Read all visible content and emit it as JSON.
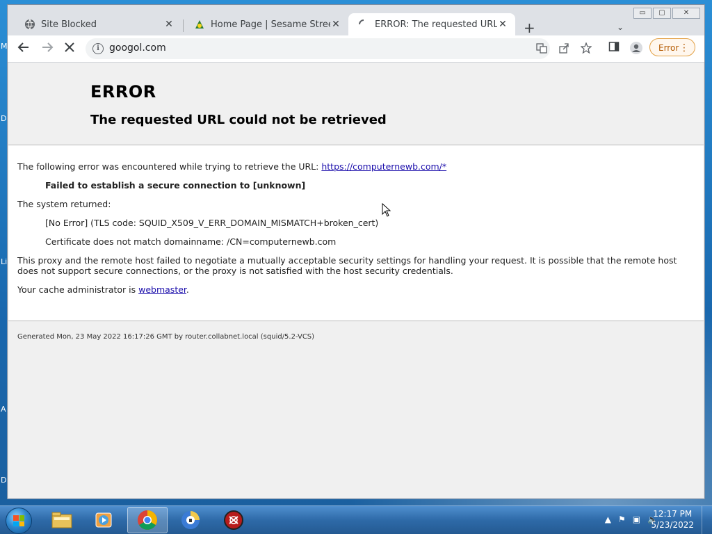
{
  "browser": {
    "tabs": [
      {
        "title": "Site Blocked",
        "icon": "globe-icon",
        "active": false
      },
      {
        "title": "Home Page | Sesame Street | PBS",
        "icon": "sesame-street-icon",
        "active": false
      },
      {
        "title": "ERROR: The requested URL could not be retrieved",
        "icon": "loading-spinner-icon",
        "active": true
      }
    ],
    "address": "googol.com",
    "error_badge": "Error",
    "window_controls": {
      "minimize": "▭",
      "maximize": "▢",
      "close": "✕"
    }
  },
  "page": {
    "heading": "ERROR",
    "subheading": "The requested URL could not be retrieved",
    "intro_text": "The following error was encountered while trying to retrieve the URL:",
    "intro_link": "https://computernewb.com/*",
    "failure": "Failed to establish a secure connection to [unknown]",
    "system_returned": "The system returned:",
    "tls_detail": "[No Error] (TLS code: SQUID_X509_V_ERR_DOMAIN_MISMATCH+broken_cert)",
    "cert_detail": "Certificate does not match domainname: /CN=computernewb.com",
    "explanation": "This proxy and the remote host failed to negotiate a mutually acceptable security settings for handling your request. It is possible that the remote host does not support secure connections, or the proxy is not satisfied with the host security credentials.",
    "admin_prefix": "Your cache administrator is ",
    "admin_link": "webmaster",
    "admin_suffix": ".",
    "footer": "Generated Mon, 23 May 2022 16:17:26 GMT by router.collabnet.local (squid/5.2-VCS)"
  },
  "desktop_fragments": [
    "M",
    "D",
    "Li",
    "A",
    "D"
  ],
  "taskbar": {
    "apps": [
      "file-explorer-icon",
      "media-player-icon",
      "chrome-icon",
      "password-manager-icon",
      "security-shield-icon"
    ],
    "time": "12:17 PM",
    "date": "5/23/2022"
  },
  "colors": {
    "link": "#1a0dab",
    "error_badge": "#b45a00",
    "header_bg": "#f0f0f0"
  }
}
